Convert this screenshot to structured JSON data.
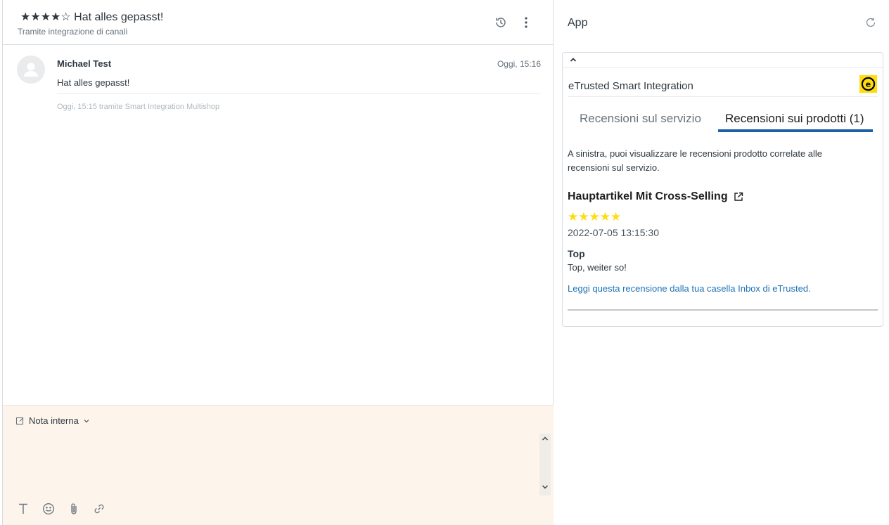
{
  "ticket": {
    "title": "★★★★☆ Hat alles gepasst!",
    "subtitle": "Tramite integrazione di canali",
    "history_icon": "history-icon",
    "more_icon": "more-vertical-icon"
  },
  "message": {
    "author": "Michael Test",
    "time": "Oggi, 15:16",
    "body": "Hat alles gepasst!",
    "meta": "Oggi, 15:15 tramite Smart Integration Multishop"
  },
  "composer": {
    "note_type": "Nota interna",
    "toolbar_icons": [
      "text-format-icon",
      "emoji-icon",
      "attachment-icon",
      "link-icon"
    ]
  },
  "app_panel": {
    "title": "App",
    "integration_name": "eTrusted Smart Integration",
    "logo_letter": "e",
    "tabs": [
      {
        "label": "Recensioni sul servizio",
        "active": false
      },
      {
        "label": "Recensioni sui prodotti (1)",
        "active": true
      }
    ],
    "intro": "A sinistra, puoi visualizzare le recensioni prodotto correlate alle recensioni sul servizio.",
    "product": {
      "name": "Hauptartikel Mit Cross-Selling",
      "rating": 5,
      "stars": "★★★★★",
      "date": "2022-07-05 13:15:30",
      "review_title": "Top",
      "review_text": "Top, weiter so!",
      "inbox_link": "Leggi questa recensione dalla tua casella Inbox di eTrusted."
    }
  },
  "colors": {
    "accent_blue": "#1f5fa8",
    "link_blue": "#1f73b7",
    "star_yellow": "#ffdc0f",
    "composer_bg": "#fdf4ec"
  }
}
